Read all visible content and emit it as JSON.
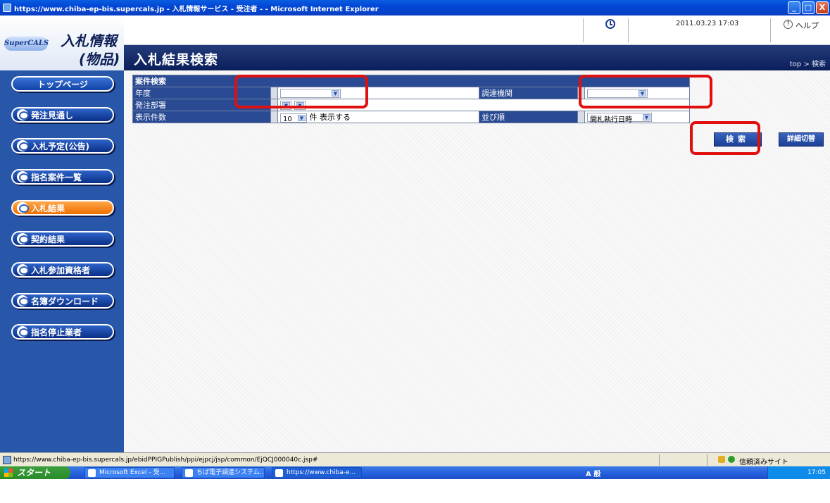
{
  "window": {
    "title": "https://www.chiba-ep-bis.supercals.jp - 入札情報サービス - 受注者 - - Microsoft Internet Explorer",
    "min": "_",
    "max": "□",
    "close": "X"
  },
  "logo": {
    "supercals": "SuperCALS",
    "line1": "入札情報",
    "line2": "(物品)"
  },
  "header": {
    "datetime": "2011.03.23 17:03",
    "help_icon": "?",
    "help_label": "ヘルプ",
    "page_title": "入札結果検索",
    "breadcrumb": "top > 検索"
  },
  "sidebar": {
    "items": [
      {
        "label": "トップページ"
      },
      {
        "label": "発注見通し"
      },
      {
        "label": "入札予定(公告)"
      },
      {
        "label": "指名案件一覧"
      },
      {
        "label": "入札結果"
      },
      {
        "label": "契約結果"
      },
      {
        "label": "入札参加資格者"
      },
      {
        "label": "名簿ダウンロード"
      },
      {
        "label": "指名停止業者"
      }
    ]
  },
  "search": {
    "section_title": "案件検索",
    "year_label": "年度",
    "year_value": "",
    "agency_label": "調達機関",
    "agency_value": "",
    "dept_label": "発注部署",
    "count_label": "表示件数",
    "count_value": "10",
    "count_suffix": "件 表示する",
    "sort_label": "並び順",
    "sort_value": "開札執行日時",
    "search_button": "検索",
    "detail_button": "詳細切替"
  },
  "status": {
    "url": "https://www.chiba-ep-bis.supercals.jp/ebidPPIGPublish/ppi/ejpcj/jsp/common/EjQCJ000040c.jsp#",
    "zone": "信頼済みサイト"
  },
  "taskbar": {
    "start": "スタート",
    "tasks": [
      {
        "label": "Microsoft Excel - 受..."
      },
      {
        "label": "ちば電子調達システム..."
      },
      {
        "label": "https://www.chiba-e..."
      }
    ],
    "ime": "A 般",
    "clock": "17:05"
  }
}
